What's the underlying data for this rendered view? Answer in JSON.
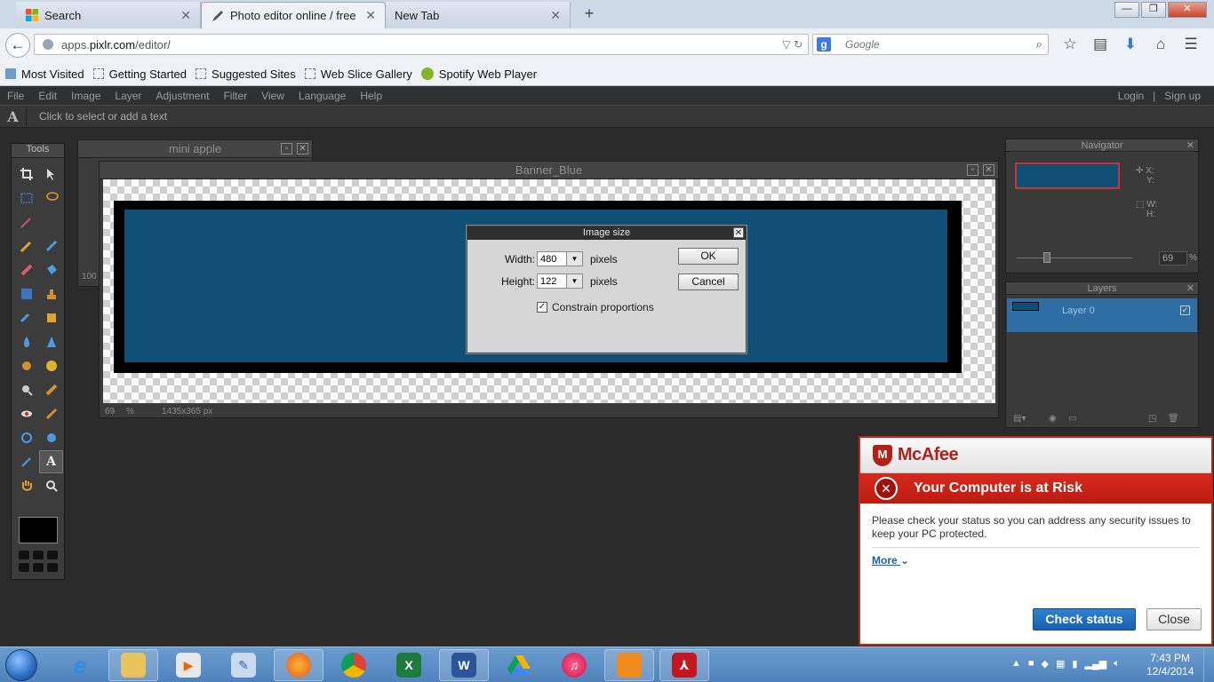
{
  "browser": {
    "tabs": [
      {
        "title": "Search",
        "state": "background"
      },
      {
        "title": "Photo editor online / free i...",
        "state": "active"
      },
      {
        "title": "New Tab",
        "state": "background"
      }
    ],
    "new_tab_label": "+",
    "url_prefix": "apps.",
    "url_host": "pixlr.com",
    "url_path": "/editor/",
    "search_placeholder": "Google",
    "bookmarks": [
      "Most Visited",
      "Getting Started",
      "Suggested Sites",
      "Web Slice Gallery",
      "Spotify Web Player"
    ]
  },
  "app": {
    "menu": [
      "File",
      "Edit",
      "Image",
      "Layer",
      "Adjustment",
      "Filter",
      "View",
      "Language",
      "Help"
    ],
    "auth": {
      "login": "Login",
      "sep": "|",
      "signup": "Sign up"
    },
    "option_hint": "Click to select or add a text",
    "tools_title": "Tools",
    "mini_doc": {
      "title": "mini apple",
      "zoom_fragment": "100"
    },
    "doc": {
      "title": "Banner_Blue",
      "zoom": "69",
      "zoom_unit": "%",
      "dimensions": "1435x365 px"
    },
    "dialog": {
      "title": "Image size",
      "width_label": "Width:",
      "width_value": "480",
      "height_label": "Height:",
      "height_value": "122",
      "unit": "pixels",
      "constrain_label": "Constrain proportions",
      "constrain_checked": true,
      "ok": "OK",
      "cancel": "Cancel"
    },
    "navigator": {
      "title": "Navigator",
      "x_label": "X:",
      "y_label": "Y:",
      "w_label": "W:",
      "h_label": "H:",
      "zoom": "69",
      "zoom_unit": "%"
    },
    "layers": {
      "title": "Layers",
      "items": [
        {
          "name": "Layer 0",
          "visible": true
        }
      ]
    }
  },
  "mcafee": {
    "brand": "McAfee",
    "title": "Your Computer is at Risk",
    "message": "Please check your status so you can address any security issues to keep your PC protected.",
    "more": "More",
    "check_status": "Check status",
    "close": "Close"
  },
  "taskbar": {
    "time": "7:43 PM",
    "date": "12/4/2014"
  },
  "colors": {
    "banner_blue": "#0f4f76",
    "mcafee_red": "#c8200e",
    "check_blue": "#1661ae"
  }
}
